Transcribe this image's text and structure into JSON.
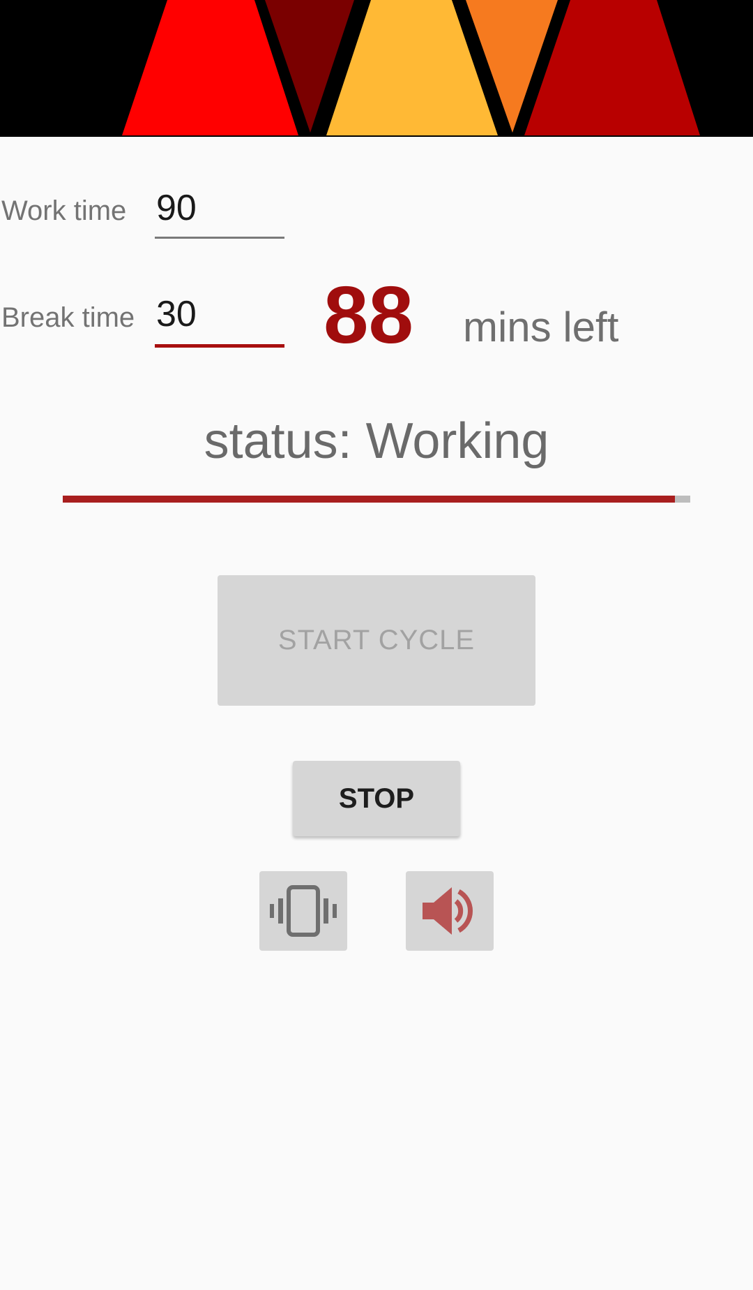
{
  "banner": {
    "colors": [
      "#000000",
      "#ff0000",
      "#7a0000",
      "#ffb935",
      "#f67a1f",
      "#b80000"
    ]
  },
  "work": {
    "label": "Work time",
    "value": "90"
  },
  "break": {
    "label": "Break time",
    "value": "30"
  },
  "timer": {
    "count": "88",
    "unit": "mins left"
  },
  "status": "status: Working",
  "progress": {
    "fraction": 0.975,
    "color": "#a81e1e",
    "track": "#bdbdbd"
  },
  "buttons": {
    "start": "START CYCLE",
    "stop": "STOP"
  },
  "toggles": {
    "vibrate_icon": "vibrate-icon",
    "sound_icon": "volume-icon"
  },
  "colors": {
    "accent": "#a80f0f",
    "background": "#fafafa",
    "button": "#d6d6d6"
  }
}
